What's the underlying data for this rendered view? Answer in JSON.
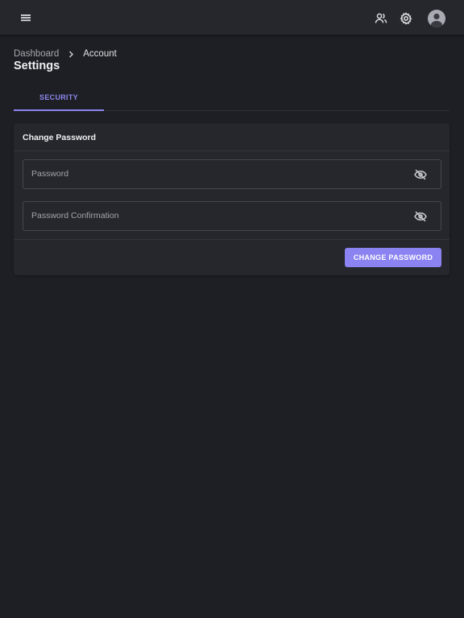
{
  "header": {
    "icons": [
      "menu-icon",
      "users-icon",
      "gear-icon",
      "account-circle-icon"
    ]
  },
  "breadcrumb": {
    "items": [
      "Dashboard",
      "Account"
    ],
    "separator_icon": "chevron-right-icon"
  },
  "page": {
    "title": "Settings"
  },
  "tabs": [
    {
      "label": "SECURITY",
      "active": true
    }
  ],
  "change_password": {
    "title": "Change Password",
    "password_placeholder": "Password",
    "confirmation_placeholder": "Password Confirmation",
    "toggle_icon": "eye-off-icon",
    "submit_label": "CHANGE PASSWORD"
  },
  "colors": {
    "background": "#1e1f24",
    "surface": "#26272d",
    "accent": "#8b83f1"
  }
}
